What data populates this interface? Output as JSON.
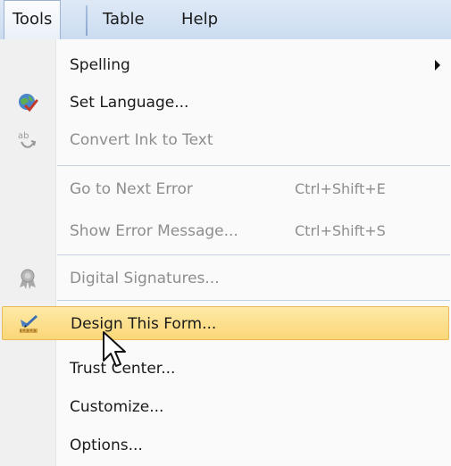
{
  "menubar": {
    "items": [
      {
        "label": "Tools",
        "active": true
      },
      {
        "label": "Table",
        "active": false
      },
      {
        "label": "Help",
        "active": false
      }
    ]
  },
  "menu": {
    "items": [
      {
        "label": "Spelling",
        "has_submenu": true,
        "enabled": true
      },
      {
        "label": "Set Language...",
        "icon": "globe-check-icon",
        "enabled": true
      },
      {
        "label": "Convert Ink to Text",
        "icon": "ink-convert-icon",
        "enabled": false
      },
      {
        "label": "Go to Next Error",
        "shortcut": "Ctrl+Shift+E",
        "enabled": false
      },
      {
        "label": "Show Error Message...",
        "shortcut": "Ctrl+Shift+S",
        "enabled": false
      },
      {
        "label": "Digital Signatures...",
        "icon": "ribbon-seal-icon",
        "enabled": false
      },
      {
        "label": "Design This Form...",
        "icon": "design-form-icon",
        "enabled": true,
        "highlighted": true
      },
      {
        "label": "Trust Center...",
        "enabled": true
      },
      {
        "label": "Customize...",
        "enabled": true
      },
      {
        "label": "Options...",
        "enabled": true
      }
    ]
  },
  "colors": {
    "menubar_bg": "#cbdcf1",
    "highlight_bg": "#fbd778",
    "highlight_border": "#e9b959",
    "disabled_text": "#8e8e8e"
  }
}
